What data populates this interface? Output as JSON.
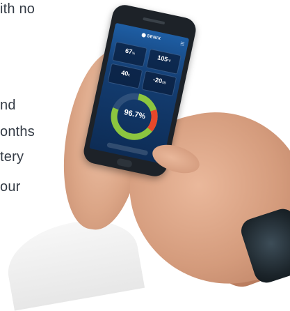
{
  "copy": {
    "lines": [
      "ith no",
      "nd",
      "onths",
      "tery",
      "our"
    ]
  },
  "app": {
    "brand": "SENIX",
    "menu_icon": "hamburger-icon",
    "tiles": [
      {
        "value": "67",
        "unit": "%"
      },
      {
        "value": "105",
        "unit": "°F"
      },
      {
        "value": "40",
        "unit": "ft"
      },
      {
        "value": "-20",
        "unit": "dB"
      }
    ],
    "gauge": {
      "percent_label": "96.7%",
      "level": 0.967,
      "ring_color": "#8cc63f",
      "alert_color": "#e8472a"
    }
  },
  "colors": {
    "screen_top": "#1e5ea4",
    "screen_bottom": "#0d2c55",
    "text": "#333a44"
  }
}
